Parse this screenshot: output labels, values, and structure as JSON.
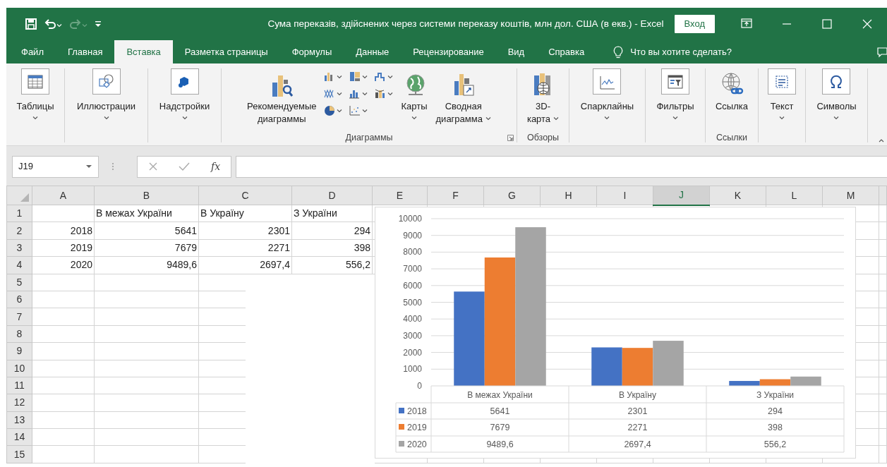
{
  "window": {
    "title": "Сума переказів, здійснених через системи переказу коштів, млн дол. США (в екв.)  -  Excel",
    "sign_in_button": "Вход"
  },
  "tabs": [
    {
      "label": "Файл",
      "selected": false
    },
    {
      "label": "Главная",
      "selected": false
    },
    {
      "label": "Вставка",
      "selected": true
    },
    {
      "label": "Разметка страницы",
      "selected": false
    },
    {
      "label": "Формулы",
      "selected": false
    },
    {
      "label": "Данные",
      "selected": false
    },
    {
      "label": "Рецензирование",
      "selected": false
    },
    {
      "label": "Вид",
      "selected": false
    },
    {
      "label": "Справка",
      "selected": false
    }
  ],
  "tell_me": "Что вы хотите сделать?",
  "ribbon": {
    "groups": [
      {
        "buttons": [
          {
            "lines": [
              "Таблицы"
            ],
            "dropdown": true
          }
        ]
      },
      {
        "buttons": [
          {
            "lines": [
              "Иллюстрации"
            ],
            "dropdown": true
          }
        ]
      },
      {
        "buttons": [
          {
            "lines": [
              "Надстройки"
            ],
            "dropdown": true
          }
        ]
      },
      {
        "label": "Диаграммы",
        "launcher": true,
        "buttons": [
          {
            "lines": [
              "Рекомендуемые",
              "диаграммы"
            ],
            "dropdown": false
          },
          {
            "kind": "gallery"
          },
          {
            "lines": [
              "Карты"
            ],
            "dropdown": true
          },
          {
            "lines": [
              "Сводная",
              "диаграмма"
            ],
            "dropdown": true
          }
        ]
      },
      {
        "label": "Обзоры",
        "buttons": [
          {
            "lines": [
              "3D-",
              "карта"
            ],
            "dropdown": true
          }
        ]
      },
      {
        "buttons": [
          {
            "lines": [
              "Спарклайны"
            ],
            "dropdown": true
          }
        ]
      },
      {
        "buttons": [
          {
            "lines": [
              "Фильтры"
            ],
            "dropdown": true
          }
        ]
      },
      {
        "label": "Ссылки",
        "buttons": [
          {
            "lines": [
              "Ссылка"
            ],
            "dropdown": false
          }
        ]
      },
      {
        "buttons": [
          {
            "lines": [
              "Текст"
            ],
            "dropdown": true
          }
        ]
      },
      {
        "buttons": [
          {
            "lines": [
              "Символы"
            ],
            "dropdown": true
          }
        ]
      }
    ]
  },
  "formula_bar": {
    "name_box": "J19",
    "function_button": "fx"
  },
  "sheet": {
    "columns": [
      {
        "label": "A",
        "selected": false
      },
      {
        "label": "B",
        "selected": false
      },
      {
        "label": "C",
        "selected": false
      },
      {
        "label": "D",
        "selected": false
      },
      {
        "label": "E",
        "selected": false
      },
      {
        "label": "F",
        "selected": false
      },
      {
        "label": "G",
        "selected": false
      },
      {
        "label": "H",
        "selected": false
      },
      {
        "label": "I",
        "selected": false
      },
      {
        "label": "J",
        "selected": true
      },
      {
        "label": "K",
        "selected": false
      },
      {
        "label": "L",
        "selected": false
      },
      {
        "label": "M",
        "selected": false
      }
    ],
    "rows": [
      {
        "label": "1",
        "kind": "labels",
        "cells": {
          "B": "В межах України",
          "C": "В Україну",
          "D": "З України"
        }
      },
      {
        "label": "2",
        "kind": "values",
        "cells": {
          "A": "2018",
          "B": "5641",
          "C": "2301",
          "D": "294"
        }
      },
      {
        "label": "3",
        "kind": "values",
        "cells": {
          "A": "2019",
          "B": "7679",
          "C": "2271",
          "D": "398"
        }
      },
      {
        "label": "4",
        "kind": "values",
        "cells": {
          "A": "2020",
          "B": "9489,6",
          "C": "2697,4",
          "D": "556,2"
        }
      },
      {
        "label": "5"
      },
      {
        "label": "6"
      },
      {
        "label": "7"
      },
      {
        "label": "8"
      },
      {
        "label": "9"
      },
      {
        "label": "10"
      },
      {
        "label": "11"
      },
      {
        "label": "12"
      },
      {
        "label": "13"
      },
      {
        "label": "14"
      },
      {
        "label": "15"
      }
    ]
  },
  "chart": {
    "chart_data": {
      "type": "bar",
      "categories": [
        "В межах України",
        "В Україну",
        "З України"
      ],
      "series": [
        {
          "name": "2018",
          "color": "#4472c4",
          "values": [
            5641,
            2301,
            294
          ]
        },
        {
          "name": "2019",
          "color": "#ed7d31",
          "values": [
            7679,
            2271,
            398
          ]
        },
        {
          "name": "2020",
          "color": "#a5a5a5",
          "values": [
            9489.6,
            2697.4,
            556.2
          ]
        }
      ],
      "grid": true,
      "legend": "bottom left",
      "ylim": [
        0,
        10000
      ],
      "yticks": [
        0,
        1000,
        2000,
        3000,
        4000,
        5000,
        6000,
        7000,
        8000,
        9000,
        10000
      ]
    },
    "data_table": {
      "rows": [
        {
          "cells": [
            "5641",
            "2301",
            "294"
          ]
        },
        {
          "cells": [
            "7679",
            "2271",
            "398"
          ]
        },
        {
          "cells": [
            "9489,6",
            "2697,4",
            "556,2"
          ]
        }
      ]
    }
  }
}
